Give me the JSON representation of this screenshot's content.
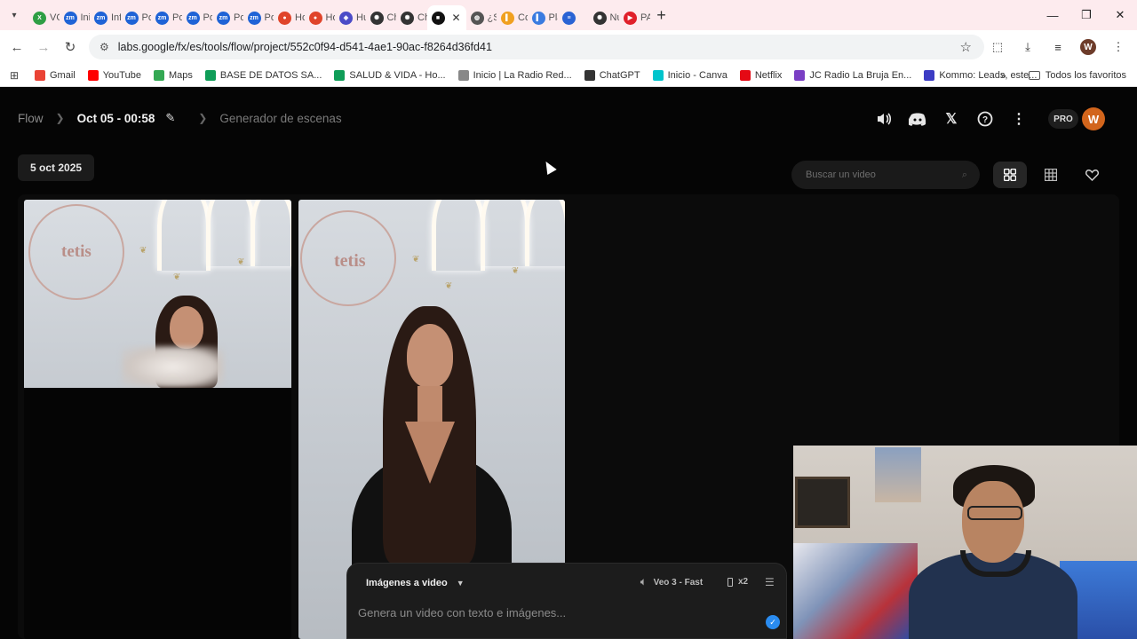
{
  "browser": {
    "tabs": [
      {
        "label": "VO",
        "color": "#2e9e44",
        "glyph": "X"
      },
      {
        "label": "Inic",
        "color": "#1f63d6",
        "glyph": "zm"
      },
      {
        "label": "Inf",
        "color": "#1f63d6",
        "glyph": "zm"
      },
      {
        "label": "Pos",
        "color": "#1f63d6",
        "glyph": "zm"
      },
      {
        "label": "Pos",
        "color": "#1f63d6",
        "glyph": "zm"
      },
      {
        "label": "Pos",
        "color": "#1f63d6",
        "glyph": "zm"
      },
      {
        "label": "Pos",
        "color": "#1f63d6",
        "glyph": "zm"
      },
      {
        "label": "Pos",
        "color": "#1f63d6",
        "glyph": "zm"
      },
      {
        "label": "Ho",
        "color": "#e0442a",
        "glyph": "●"
      },
      {
        "label": "Ho",
        "color": "#e0442a",
        "glyph": "●"
      },
      {
        "label": "Hu",
        "color": "#4b4bc7",
        "glyph": "◈"
      },
      {
        "label": "Ch",
        "color": "#333333",
        "glyph": "✺"
      },
      {
        "label": "Ch",
        "color": "#333333",
        "glyph": "✺"
      },
      {
        "label": "",
        "color": "#111111",
        "glyph": "■",
        "active": true
      },
      {
        "label": "¿Sa",
        "color": "#555555",
        "glyph": "◍"
      },
      {
        "label": "Co",
        "color": "#f0a020",
        "glyph": "▌"
      },
      {
        "label": "Pla",
        "color": "#3a7be0",
        "glyph": "▌"
      },
      {
        "label": "",
        "color": "#2a63d4",
        "glyph": "≡"
      },
      {
        "label": "Nu",
        "color": "#333333",
        "glyph": "✺"
      },
      {
        "label": "PA",
        "color": "#e0202a",
        "glyph": "▶"
      }
    ],
    "url": "labs.google/fx/es/tools/flow/project/552c0f94-d541-4ae1-90ac-f8264d36fd41",
    "profile_initial": "W",
    "bookmarks": [
      {
        "label": "Gmail",
        "color": "#ea4335"
      },
      {
        "label": "YouTube",
        "color": "#ff0000"
      },
      {
        "label": "Maps",
        "color": "#34a853"
      },
      {
        "label": "BASE DE DATOS SA...",
        "color": "#0f9d58"
      },
      {
        "label": "SALUD & VIDA - Ho...",
        "color": "#0f9d58"
      },
      {
        "label": "Inicio | La Radio Red...",
        "color": "#888888"
      },
      {
        "label": "ChatGPT",
        "color": "#333333"
      },
      {
        "label": "Inicio - Canva",
        "color": "#00c4cc"
      },
      {
        "label": "Netflix",
        "color": "#e50914"
      },
      {
        "label": "JC Radio La Bruja En...",
        "color": "#7a3fc4"
      },
      {
        "label": "Kommo: Leads, este...",
        "color": "#3c3cc4"
      }
    ],
    "all_bookmarks_label": "Todos los favoritos"
  },
  "app": {
    "breadcrumb": {
      "root": "Flow",
      "project": "Oct 05 - 00:58",
      "tool": "Generador de escenas"
    },
    "pro_badge": "PRO",
    "avatar_initial": "W",
    "date_label": "5 oct 2025",
    "search_placeholder": "Buscar un video",
    "card1": {
      "logo_text": "tetis"
    },
    "card2": {
      "logo_text": "tetis"
    },
    "composer": {
      "mode_label": "Imágenes a video",
      "model_label": "Veo 3 - Fast",
      "count_label": "x2",
      "prompt_placeholder": "Genera un video con texto e imágenes..."
    }
  }
}
